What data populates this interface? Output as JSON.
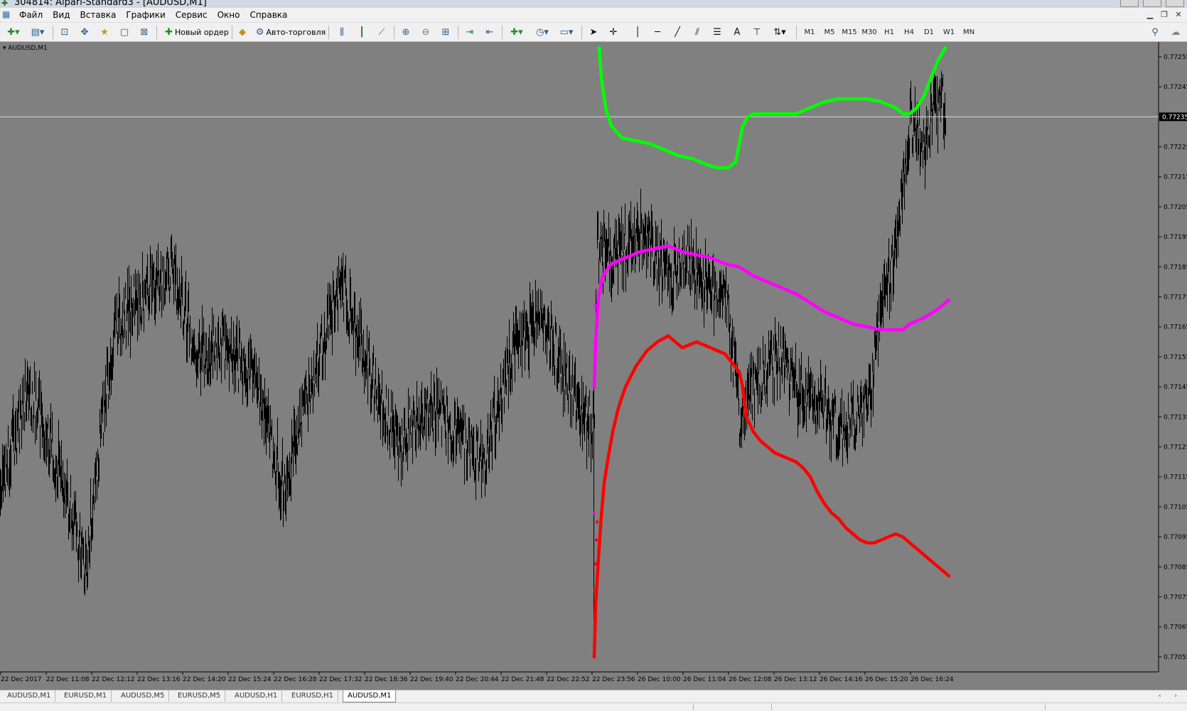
{
  "window": {
    "title": "304814: Alpari-Standard3 - [AUDUSD,M1]"
  },
  "menu": {
    "items": [
      "Файл",
      "Вид",
      "Вставка",
      "Графики",
      "Сервис",
      "Окно",
      "Справка"
    ]
  },
  "toolbar": {
    "new_order_label": "Новый ордер",
    "autotrading_label": "Авто-торговля",
    "timeframes": [
      "M1",
      "M5",
      "M15",
      "M30",
      "H1",
      "H4",
      "D1",
      "W1",
      "MN"
    ]
  },
  "chart": {
    "label": "AUDUSD,M1",
    "current_price_label": "0.77235",
    "background_color": "#808080",
    "price_line_color": "#d8d8d8",
    "upper_band_color": "#00ff00",
    "middle_band_color": "#ff00ff",
    "lower_band_color": "#ff0000",
    "candle_color": "#000000"
  },
  "chart_data": {
    "type": "line",
    "y_axis_side": "right",
    "ylim": [
      0.7705,
      0.7726
    ],
    "y_ticks": [
      "0.77255",
      "0.77245",
      "0.77235",
      "0.77225",
      "0.77215",
      "0.77205",
      "0.77195",
      "0.77185",
      "0.77175",
      "0.77165",
      "0.77155",
      "0.77145",
      "0.77135",
      "0.77125",
      "0.77115",
      "0.77105",
      "0.77095",
      "0.77085",
      "0.77075",
      "0.77065",
      "0.77055"
    ],
    "x_ticks": [
      "22 Dec 2017",
      "22 Dec 11:08",
      "22 Dec 12:12",
      "22 Dec 13:16",
      "22 Dec 14:20",
      "22 Dec 15:24",
      "22 Dec 16:28",
      "22 Dec 17:32",
      "22 Dec 18:36",
      "22 Dec 19:40",
      "22 Dec 20:44",
      "22 Dec 21:48",
      "22 Dec 22:52",
      "22 Dec 23:56",
      "26 Dec 10:00",
      "26 Dec 11:04",
      "26 Dec 12:08",
      "26 Dec 13:12",
      "26 Dec 14:16",
      "26 Dec 15:20",
      "26 Dec 16:24"
    ],
    "current_price": 0.77235,
    "price": {
      "x": [
        0,
        40,
        80,
        120,
        160,
        200,
        240,
        280,
        320,
        360,
        400,
        440,
        480,
        520,
        560,
        600,
        640,
        680,
        720,
        760,
        800,
        835,
        840,
        860,
        880,
        900,
        920,
        940,
        960,
        980,
        1000,
        1020,
        1040,
        1060,
        1080,
        1100,
        1120,
        1140,
        1160,
        1180,
        1200,
        1220,
        1240,
        1260,
        1280,
        1300,
        1320,
        1330
      ],
      "y": [
        0.7711,
        0.77145,
        0.7712,
        0.77085,
        0.77165,
        0.77175,
        0.77185,
        0.77155,
        0.7716,
        0.77145,
        0.7711,
        0.7715,
        0.7718,
        0.7715,
        0.77125,
        0.7714,
        0.7713,
        0.7712,
        0.77155,
        0.7717,
        0.77145,
        0.7713,
        0.7719,
        0.77188,
        0.77192,
        0.77195,
        0.7719,
        0.7718,
        0.77188,
        0.77185,
        0.77175,
        0.7718,
        0.77135,
        0.77145,
        0.7715,
        0.77155,
        0.77145,
        0.7714,
        0.7714,
        0.7713,
        0.77135,
        0.77138,
        0.7717,
        0.7719,
        0.77235,
        0.77225,
        0.7724,
        0.77238
      ]
    },
    "series": [
      {
        "x": [
          843,
          846,
          852,
          860,
          875,
          895,
          915,
          935,
          955,
          975,
          995,
          1010,
          1025,
          1035,
          1045,
          1052,
          1060,
          1080,
          1100,
          1120,
          1140,
          1160,
          1180,
          1200,
          1220,
          1240,
          1260,
          1270,
          1280,
          1290,
          1300,
          1310,
          1320,
          1330
        ],
        "y": [
          0.77258,
          0.77248,
          0.77238,
          0.77232,
          0.77228,
          0.77227,
          0.77226,
          0.77224,
          0.77222,
          0.77221,
          0.77219,
          0.77218,
          0.77218,
          0.7722,
          0.77232,
          0.77235,
          0.77236,
          0.77236,
          0.77236,
          0.77236,
          0.77238,
          0.7724,
          0.77241,
          0.77241,
          0.77241,
          0.7724,
          0.77238,
          0.77236,
          0.77236,
          0.77238,
          0.77242,
          0.77248,
          0.77254,
          0.77258
        ]
      },
      {
        "x": [
          836,
          838,
          842,
          848,
          860,
          880,
          900,
          920,
          940,
          960,
          980,
          1000,
          1020,
          1040,
          1060,
          1080,
          1100,
          1120,
          1140,
          1160,
          1180,
          1200,
          1220,
          1240,
          1260,
          1270,
          1280,
          1300,
          1320,
          1335
        ],
        "y": [
          0.77145,
          0.7716,
          0.77175,
          0.77182,
          0.77186,
          0.77188,
          0.7719,
          0.77191,
          0.77192,
          0.7719,
          0.77189,
          0.77188,
          0.77186,
          0.77185,
          0.77182,
          0.7718,
          0.77178,
          0.77176,
          0.77173,
          0.7717,
          0.77168,
          0.77166,
          0.77165,
          0.77164,
          0.77164,
          0.77164,
          0.77166,
          0.77168,
          0.77171,
          0.77174
        ]
      },
      {
        "x": [
          836,
          838,
          842,
          846,
          850,
          856,
          862,
          870,
          880,
          895,
          910,
          925,
          940,
          950,
          960,
          970,
          980,
          990,
          1000,
          1010,
          1020,
          1030,
          1040,
          1045,
          1050,
          1060,
          1070,
          1080,
          1090,
          1100,
          1110,
          1120,
          1130,
          1140,
          1150,
          1160,
          1170,
          1180,
          1190,
          1200,
          1210,
          1220,
          1230,
          1240,
          1250,
          1260,
          1270,
          1280,
          1290,
          1300,
          1310,
          1320,
          1330,
          1335
        ],
        "y": [
          0.77055,
          0.77072,
          0.77088,
          0.77102,
          0.77113,
          0.77122,
          0.7713,
          0.77138,
          0.77145,
          0.77152,
          0.77157,
          0.7716,
          0.77162,
          0.7716,
          0.77158,
          0.77159,
          0.7716,
          0.77159,
          0.77158,
          0.77157,
          0.77156,
          0.77153,
          0.7715,
          0.77145,
          0.77135,
          0.7713,
          0.77127,
          0.77125,
          0.77123,
          0.77122,
          0.77121,
          0.7712,
          0.77118,
          0.77115,
          0.7711,
          0.77106,
          0.77103,
          0.77101,
          0.77098,
          0.77096,
          0.77094,
          0.77093,
          0.77093,
          0.77094,
          0.77095,
          0.77096,
          0.77095,
          0.77093,
          0.77091,
          0.77089,
          0.77087,
          0.77085,
          0.77083,
          0.77082
        ]
      }
    ]
  },
  "tabs": [
    "AUDUSD,M1",
    "EURUSD,M1",
    "AUDUSD,M5",
    "EURUSD,M5",
    "AUDUSD,H1",
    "EURUSD,H1",
    "AUDUSD,M1"
  ],
  "active_tab": 6
}
